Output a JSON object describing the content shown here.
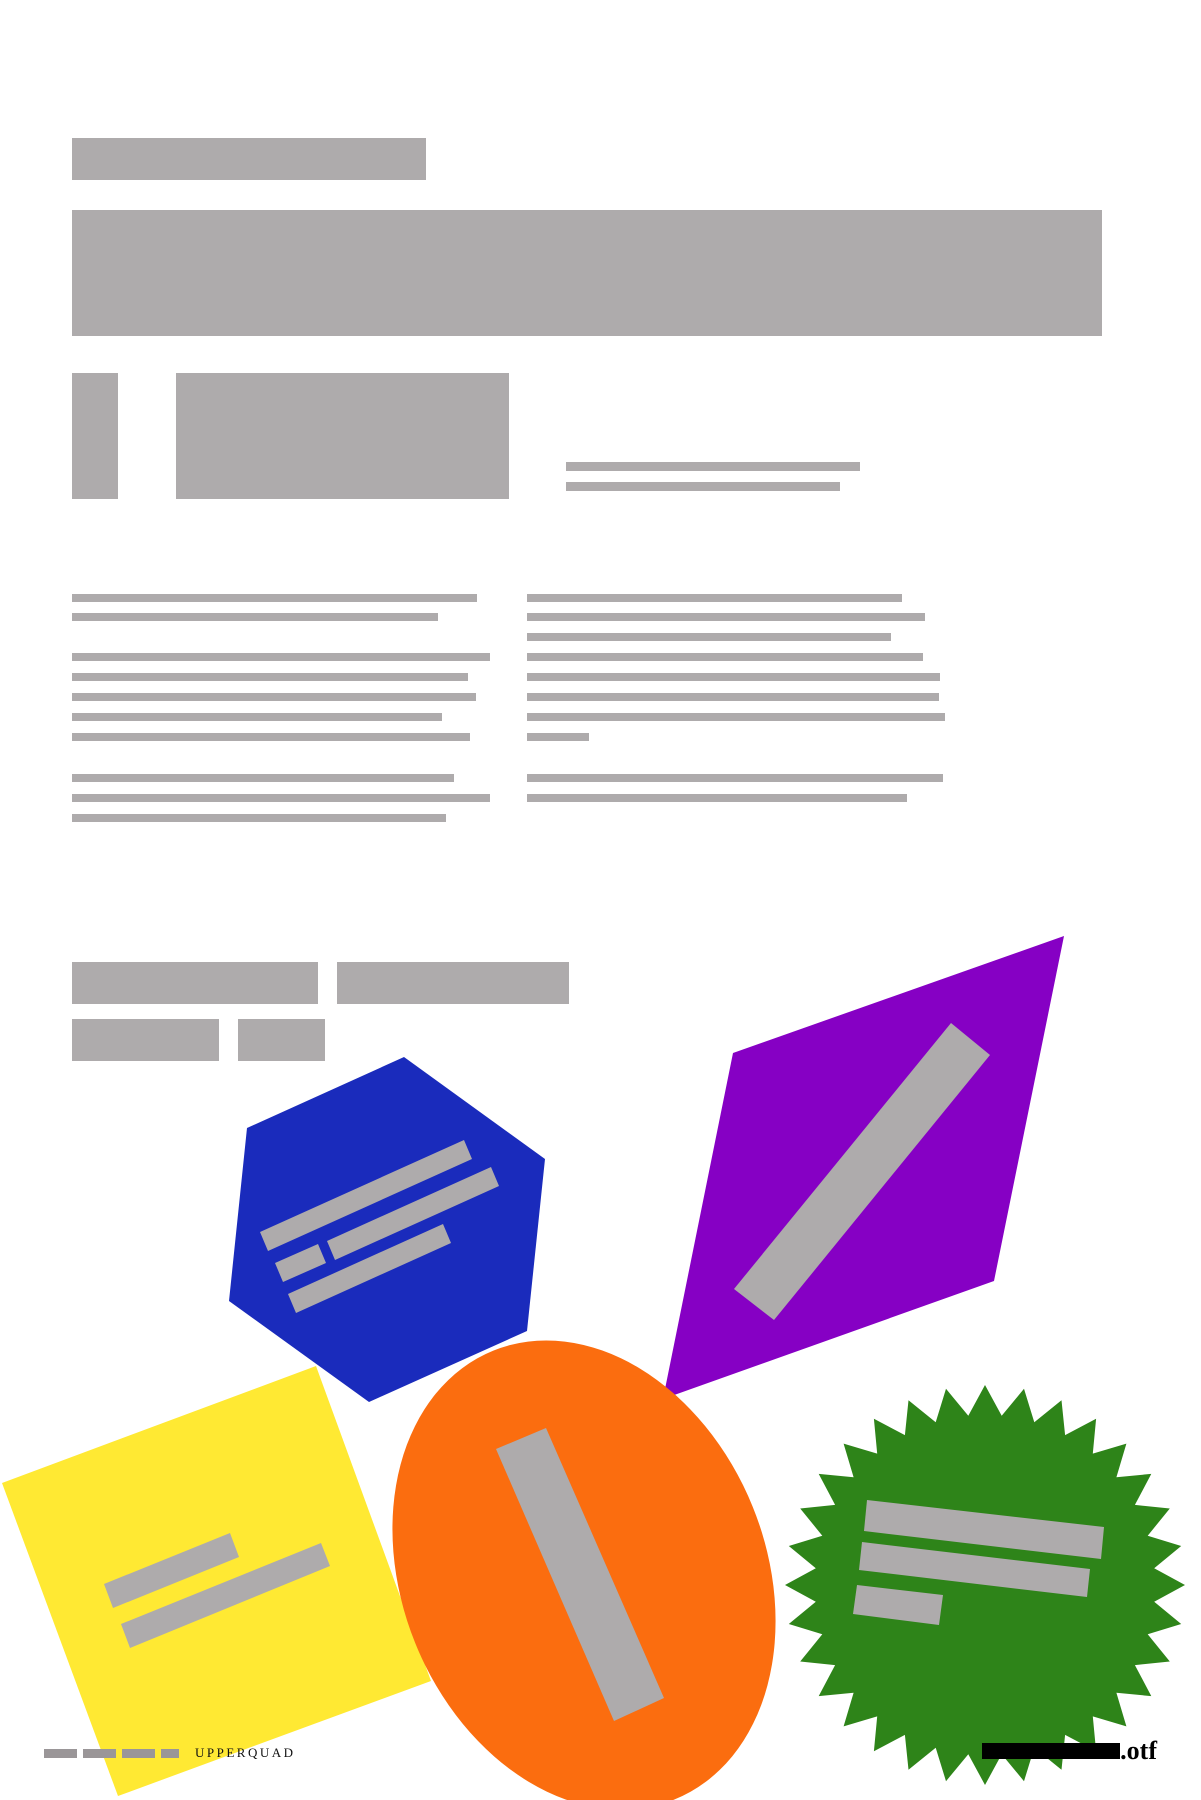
{
  "footer": {
    "brand": "UPPERQUAD",
    "extension": ".otf"
  },
  "colors": {
    "redaction": "#aeabac",
    "hexagon": "#1a2bbc",
    "diamond": "#8600c4",
    "square": "#ffe933",
    "ellipse": "#fb6d0f",
    "starburst": "#2e8419",
    "background": "#ffffff"
  },
  "shapes": [
    {
      "name": "hexagon-shape",
      "color_key": "hexagon",
      "label_lines": 3
    },
    {
      "name": "diamond-shape",
      "color_key": "diamond",
      "label_lines": 1
    },
    {
      "name": "square-shape",
      "color_key": "square",
      "label_lines": 2
    },
    {
      "name": "ellipse-shape",
      "color_key": "ellipse",
      "label_lines": 1
    },
    {
      "name": "starburst-shape",
      "color_key": "starburst",
      "label_lines": 3
    }
  ]
}
